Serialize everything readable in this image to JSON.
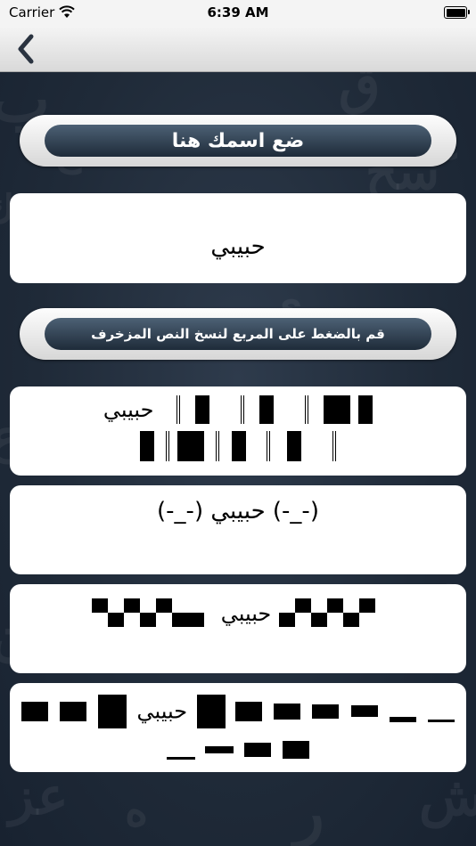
{
  "status_bar": {
    "carrier": "Carrier",
    "time": "6:39 AM"
  },
  "nav": {
    "back_icon": "chevron-left-icon"
  },
  "name_banner": {
    "label": "ضع اسمك هنا"
  },
  "name_input": {
    "value": "حبيبي"
  },
  "copy_banner": {
    "label": "قم بالضغط على المربع لنسخ النص المزخرف"
  },
  "decorated": [
    {
      "text": "حبيبي"
    },
    {
      "prefix": "(-_-)",
      "text": "حبيبي",
      "suffix": "(-_-)"
    },
    {
      "text": "حبيبي"
    },
    {
      "text": "حبيبي"
    }
  ],
  "colors": {
    "background": "#1f2a38",
    "banner_dark": "#2a3a4b",
    "card": "#ffffff"
  }
}
